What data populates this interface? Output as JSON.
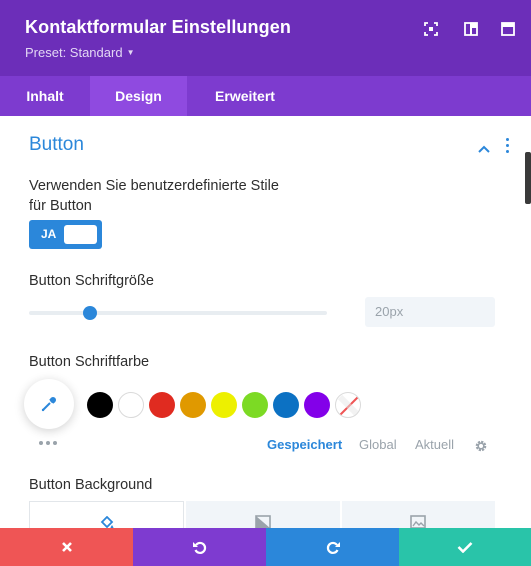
{
  "header": {
    "title": "Kontaktformular Einstellungen",
    "preset": "Preset: Standard",
    "icons": [
      "focus-icon",
      "split-view-icon",
      "expand-icon"
    ]
  },
  "tabs": [
    {
      "label": "Inhalt",
      "active": false
    },
    {
      "label": "Design",
      "active": true
    },
    {
      "label": "Erweitert",
      "active": false
    }
  ],
  "section": {
    "title": "Button",
    "custom_styles_label_line1": "Verwenden Sie benutzerdefinierte Stile",
    "custom_styles_label_line2": "für Button",
    "toggle_label": "JA",
    "font_size_label": "Button Schriftgröße",
    "font_size_placeholder": "20px",
    "font_size_slider_fraction": 0.19,
    "font_color_label": "Button Schriftfarbe",
    "swatches": [
      "#000000",
      "#ffffff",
      "#e02b20",
      "#e09900",
      "#edf000",
      "#7cda24",
      "#0c71c3",
      "#8300e9",
      "transparent"
    ],
    "color_tabs": [
      {
        "label": "Gespeichert",
        "active": true
      },
      {
        "label": "Global",
        "active": false
      },
      {
        "label": "Aktuell",
        "active": false
      }
    ],
    "background_label": "Button Background"
  },
  "footer": {
    "buttons": [
      {
        "name": "close",
        "color": "#ef5555"
      },
      {
        "name": "undo",
        "color": "#7e3bd0"
      },
      {
        "name": "redo",
        "color": "#2b87da"
      },
      {
        "name": "save",
        "color": "#29c4a9"
      }
    ]
  },
  "colors": {
    "header": "#6c2eb9",
    "tabs": "#7d3bcf",
    "active_tab": "#8f4ae0",
    "accent": "#2b87da"
  }
}
